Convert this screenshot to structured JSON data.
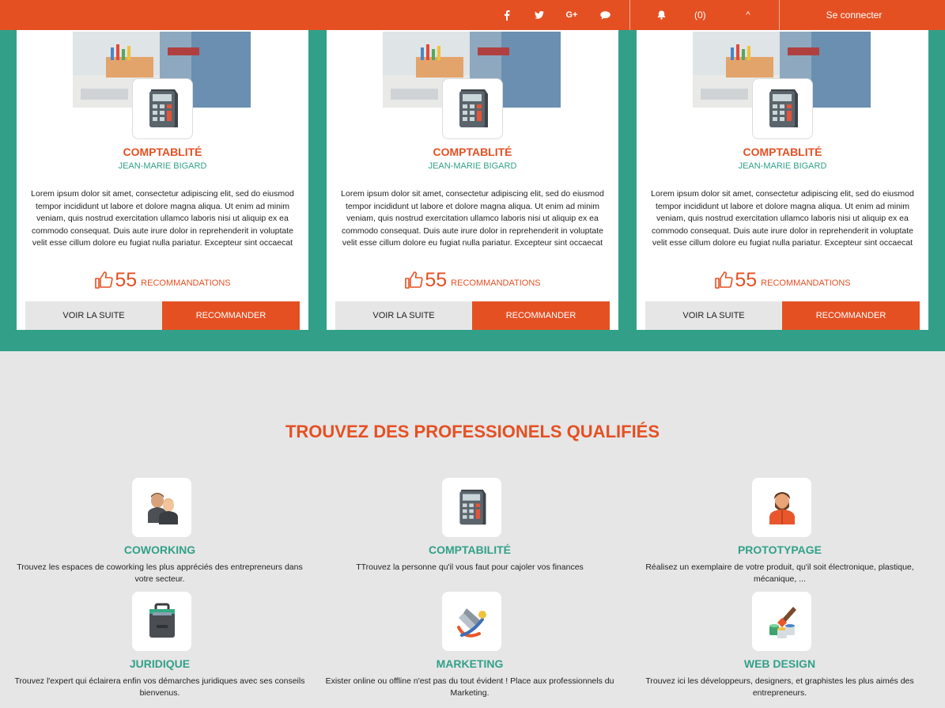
{
  "colors": {
    "accent": "#e55023",
    "teal": "#32a089",
    "background": "#e6e6e6"
  },
  "topbar": {
    "social_icons": [
      "facebook-icon",
      "twitter-icon",
      "google-plus-icon",
      "chat-bubble-icon"
    ],
    "social_glyphs": [
      "f",
      "•",
      "G+",
      "●"
    ],
    "notification_count": "(0)",
    "caret": "^",
    "login_label": "Se connecter"
  },
  "cards": [
    {
      "title": "COMPTABLITÉ",
      "author": "JEAN-MARIE BIGARD",
      "description": "Lorem ipsum dolor sit amet, consectetur adipiscing elit, sed do eiusmod tempor incididunt ut labore et dolore magna aliqua. Ut enim ad minim veniam, quis nostrud exercitation ullamco laboris nisi ut aliquip ex ea commodo consequat. Duis aute irure dolor in reprehenderit in voluptate velit esse cillum dolore eu fugiat nulla pariatur. Excepteur sint occaecat",
      "recommendations": "55",
      "recommendations_label": "RECOMMANDATIONS",
      "more_label": "VOIR LA SUITE",
      "recommend_label": "RECOMMANDER"
    },
    {
      "title": "COMPTABLITÉ",
      "author": "JEAN-MARIE BIGARD",
      "description": "Lorem ipsum dolor sit amet, consectetur adipiscing elit, sed do eiusmod tempor incididunt ut labore et dolore magna aliqua. Ut enim ad minim veniam, quis nostrud exercitation ullamco laboris nisi ut aliquip ex ea commodo consequat. Duis aute irure dolor in reprehenderit in voluptate velit esse cillum dolore eu fugiat nulla pariatur. Excepteur sint occaecat",
      "recommendations": "55",
      "recommendations_label": "RECOMMANDATIONS",
      "more_label": "VOIR LA SUITE",
      "recommend_label": "RECOMMANDER"
    },
    {
      "title": "COMPTABLITÉ",
      "author": "JEAN-MARIE BIGARD",
      "description": "Lorem ipsum dolor sit amet, consectetur adipiscing elit, sed do eiusmod tempor incididunt ut labore et dolore magna aliqua. Ut enim ad minim veniam, quis nostrud exercitation ullamco laboris nisi ut aliquip ex ea commodo consequat. Duis aute irure dolor in reprehenderit in voluptate velit esse cillum dolore eu fugiat nulla pariatur. Excepteur sint occaecat",
      "recommendations": "55",
      "recommendations_label": "RECOMMANDATIONS",
      "more_label": "VOIR LA SUITE",
      "recommend_label": "RECOMMANDER"
    }
  ],
  "section": {
    "title": "TROUVEZ DES PROFESSIONELS QUALIFIÉS",
    "categories": [
      {
        "title": "COWORKING",
        "icon": "coworking-people-icon",
        "description": "Trouvez les espaces de coworking les plus appréciés des entrepreneurs dans votre secteur."
      },
      {
        "title": "COMPTABILITÉ",
        "icon": "calculator-icon",
        "description": "TTrouvez la personne qu'il vous faut pour cajoler vos finances"
      },
      {
        "title": "PROTOTYPAGE",
        "icon": "bearded-man-icon",
        "description": "Réalisez un exemplaire de votre produit, qu'il soit électronique, plastique, mécanique, ..."
      },
      {
        "title": "JURIDIQUE",
        "icon": "briefcase-icon",
        "description": "Trouvez l'expert qui éclairera enfin vos démarches juridiques avec ses conseils bienvenus."
      },
      {
        "title": "MARKETING",
        "icon": "megaphone-icon",
        "description": "Exister online ou offline n'est pas du tout évident ! Place aux professionnels du Marketing."
      },
      {
        "title": "WEB DESIGN",
        "icon": "paint-pots-icon",
        "description": "Trouvez ici les développeurs, designers, et graphistes les plus aimés des entrepreneurs."
      }
    ]
  }
}
